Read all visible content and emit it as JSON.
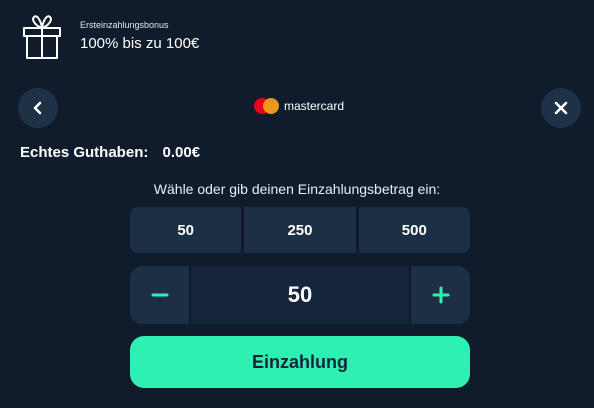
{
  "bonus": {
    "label": "Ersteinzahlungsbonus",
    "offer": "100% bis zu 100€",
    "icon": "gift-icon"
  },
  "nav": {
    "back_icon": "chevron-left-icon",
    "close_icon": "close-icon"
  },
  "payment_method": {
    "name": "mastercard",
    "logo_colors": {
      "red": "#eb001b",
      "orange": "#f79e1b"
    }
  },
  "balance": {
    "label": "Echtes Guthaben:",
    "value": "0.00€"
  },
  "amount_prompt": "Wähle oder gib deinen Einzahlungsbetrag ein:",
  "presets": [
    "50",
    "250",
    "500"
  ],
  "stepper": {
    "minus_icon": "minus-icon",
    "plus_icon": "plus-icon",
    "value": "50"
  },
  "deposit_button": "Einzahlung",
  "colors": {
    "background": "#101c2c",
    "panel": "#1d2f44",
    "accent": "#2ef0b3"
  }
}
